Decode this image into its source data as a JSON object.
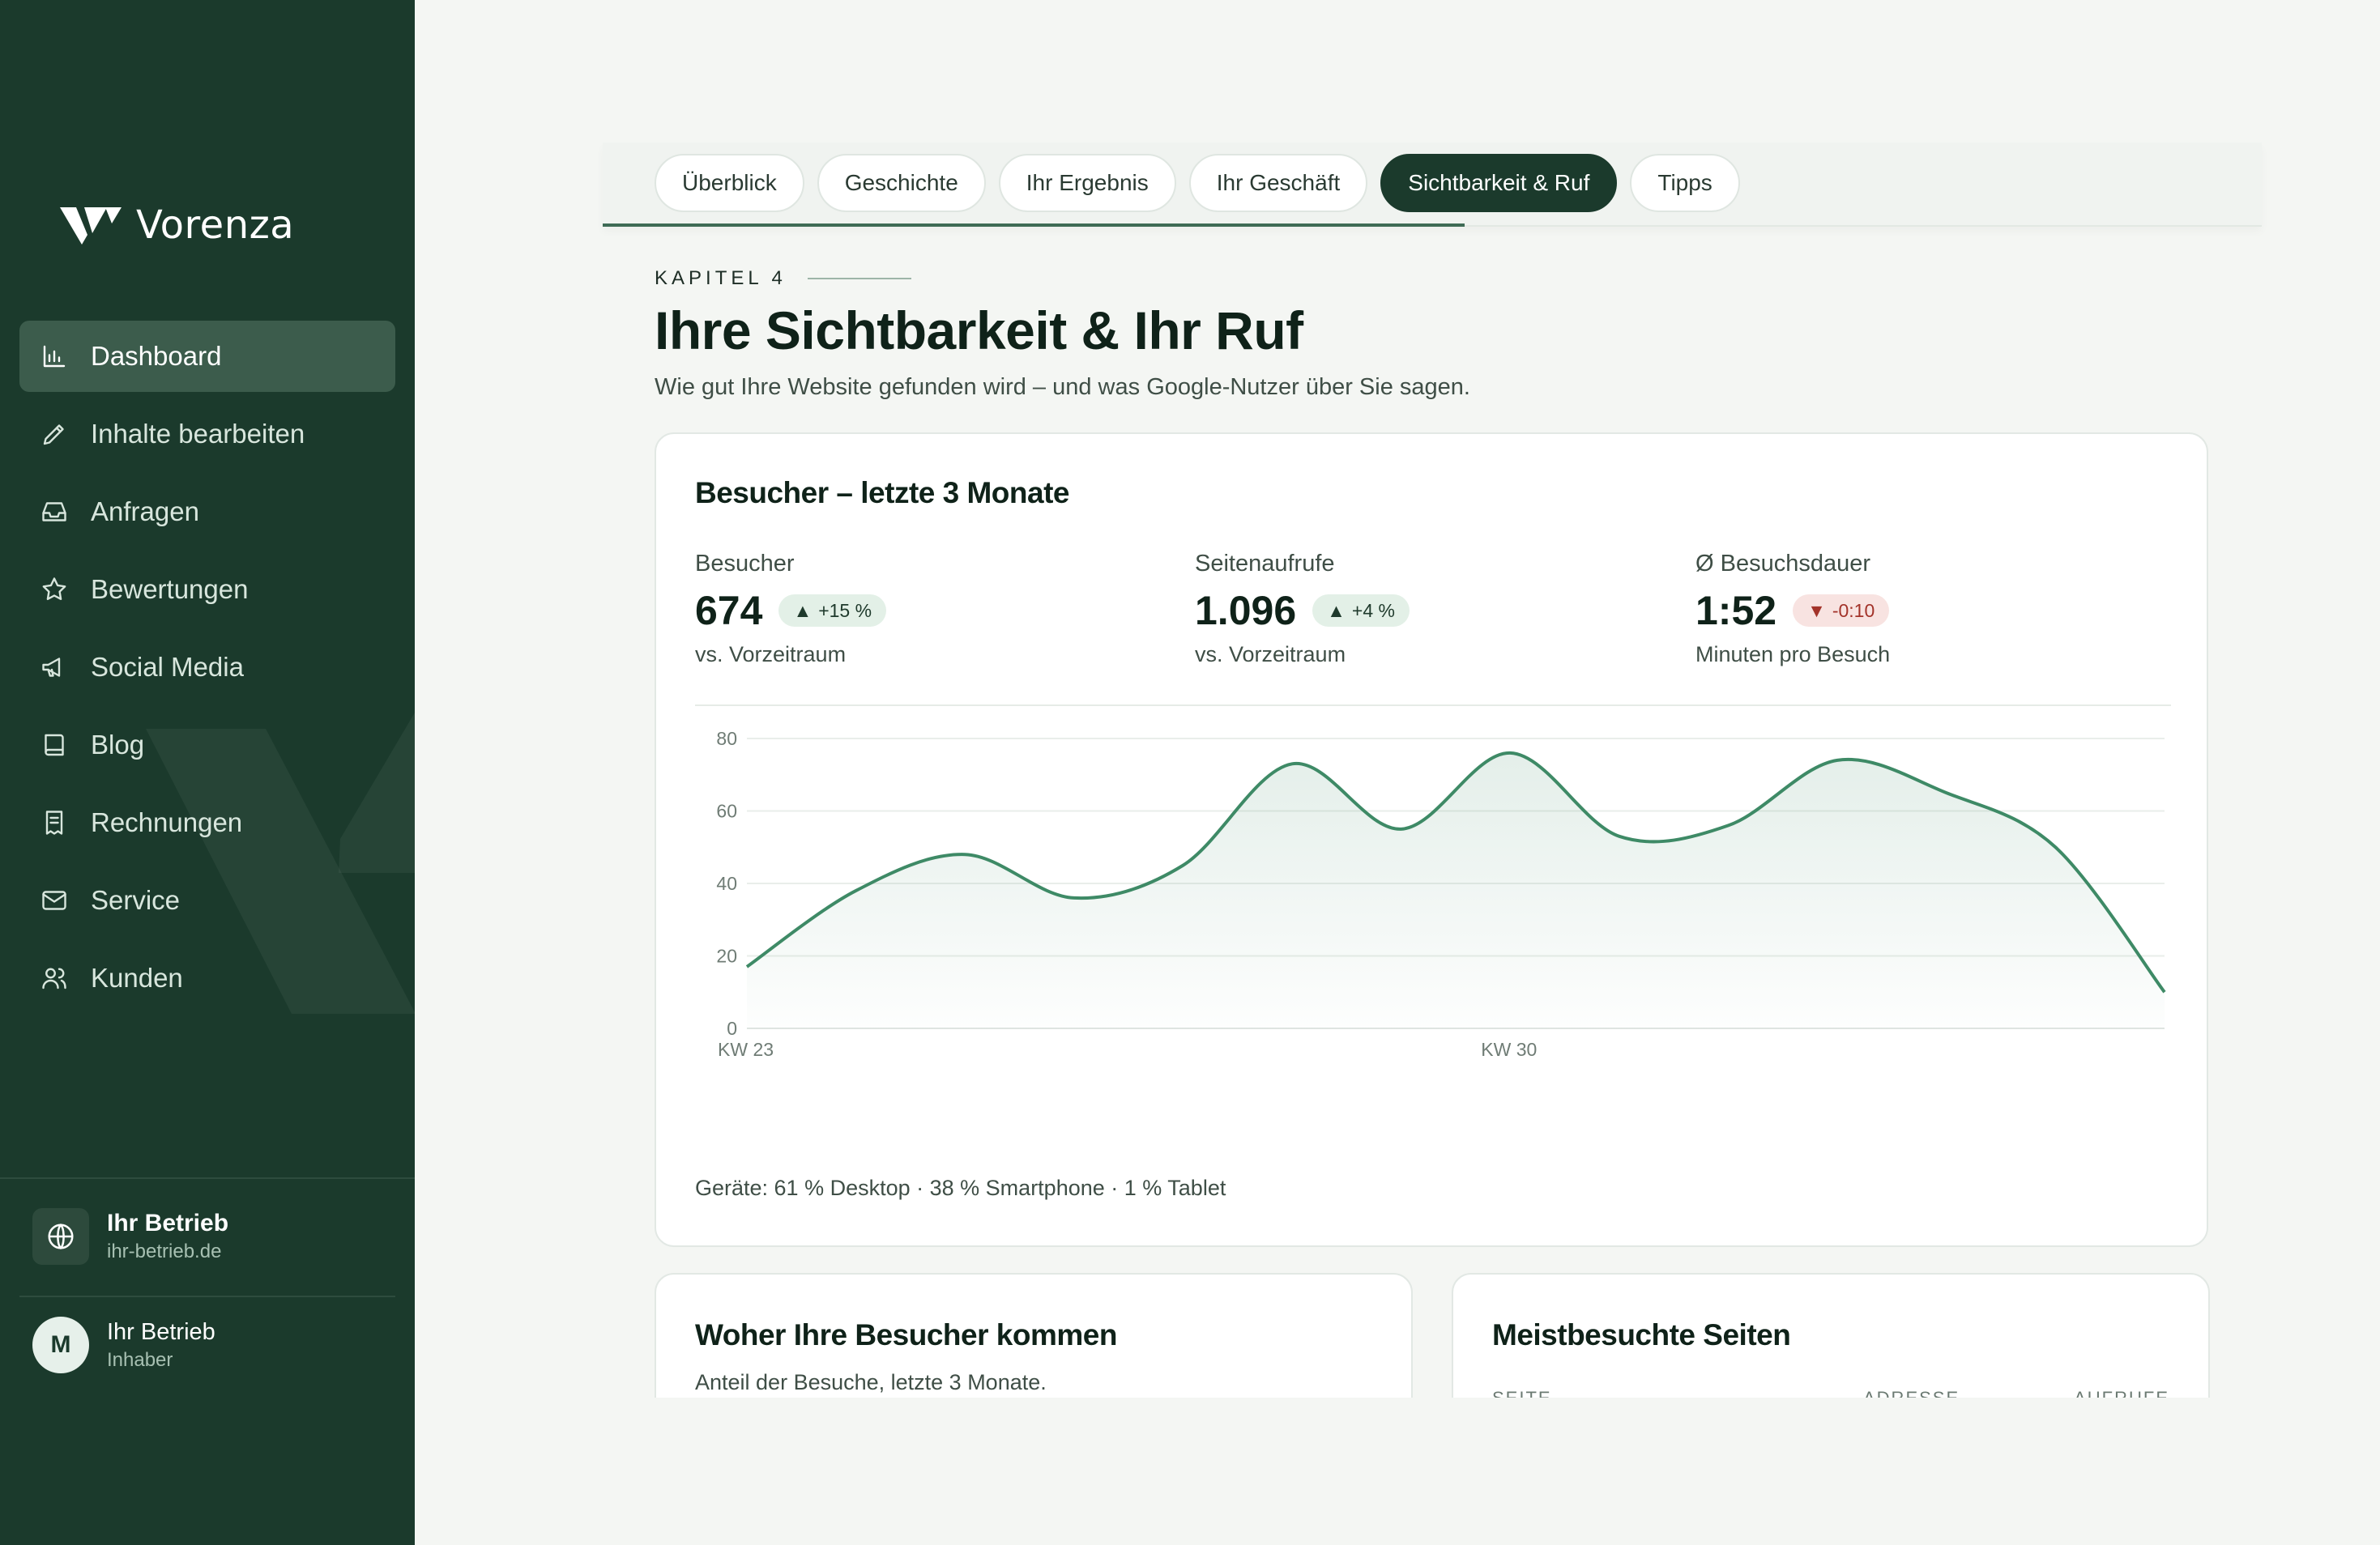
{
  "app": {
    "brand": "Vorenza"
  },
  "sidebar": {
    "items": [
      {
        "label": "Dashboard",
        "icon": "bar-chart-icon",
        "active": true
      },
      {
        "label": "Inhalte bearbeiten",
        "icon": "pencil-icon"
      },
      {
        "label": "Anfragen",
        "icon": "inbox-icon"
      },
      {
        "label": "Bewertungen",
        "icon": "star-icon"
      },
      {
        "label": "Social Media",
        "icon": "megaphone-icon"
      },
      {
        "label": "Blog",
        "icon": "book-icon"
      },
      {
        "label": "Rechnungen",
        "icon": "receipt-icon"
      },
      {
        "label": "Service",
        "icon": "mail-icon"
      },
      {
        "label": "Kunden",
        "icon": "users-icon"
      }
    ],
    "business": {
      "name": "Ihr Betrieb",
      "domain": "ihr-betrieb.de",
      "icon": "globe-icon"
    },
    "user": {
      "initial": "M",
      "name": "Ihr Betrieb",
      "role": "Inhaber"
    }
  },
  "tabs": [
    {
      "label": "Überblick"
    },
    {
      "label": "Geschichte"
    },
    {
      "label": "Ihr Ergebnis"
    },
    {
      "label": "Ihr Geschäft"
    },
    {
      "label": "Sichtbarkeit & Ruf",
      "active": true
    },
    {
      "label": "Tipps"
    }
  ],
  "chapter": {
    "eyebrow": "KAPITEL 4",
    "title": "Ihre Sichtbarkeit & Ihr Ruf",
    "subtitle": "Wie gut Ihre Website gefunden wird – und was Google-Nutzer über Sie sagen."
  },
  "visitors_card": {
    "title": "Besucher – letzte 3 Monate",
    "stats": [
      {
        "label": "Besucher",
        "value": "674",
        "delta": "+15 %",
        "trend": "up",
        "note": "vs. Vorzeitraum"
      },
      {
        "label": "Seitenaufrufe",
        "value": "1.096",
        "delta": "+4 %",
        "trend": "up",
        "note": "vs. Vorzeitraum"
      },
      {
        "label": "Ø Besuchsdauer",
        "value": "1:52",
        "delta": "-0:10",
        "trend": "down",
        "note": "Minuten pro Besuch"
      }
    ],
    "devices": "Geräte: 61 % Desktop · 38 % Smartphone · 1 % Tablet"
  },
  "chart_data": {
    "type": "area",
    "title": "",
    "xlabel": "",
    "ylabel": "",
    "ylim": [
      0,
      80
    ],
    "yticks": [
      0,
      20,
      40,
      60,
      80
    ],
    "x_tick_labels": [
      {
        "label": "KW 23",
        "index": 0
      },
      {
        "label": "KW 30",
        "index": 7
      }
    ],
    "grid": true,
    "color": "#3e8a66",
    "series": [
      {
        "values": [
          17,
          38,
          48,
          36,
          45,
          73,
          55,
          76,
          53,
          56,
          74,
          65,
          50,
          10
        ]
      }
    ]
  },
  "sources_card": {
    "title": "Woher Ihre Besucher kommen",
    "subtitle": "Anteil der Besuche, letzte 3 Monate."
  },
  "pages_card": {
    "title": "Meistbesuchte Seiten",
    "columns": [
      "SEITE",
      "ADRESSE",
      "AUFRUFE"
    ]
  }
}
